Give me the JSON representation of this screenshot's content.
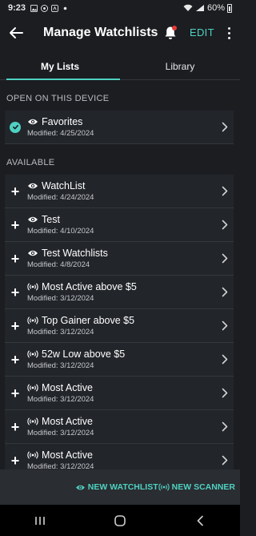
{
  "status": {
    "time": "9:23",
    "battery": "60%"
  },
  "header": {
    "title": "Manage Watchlists",
    "edit_label": "EDIT"
  },
  "tabs": [
    {
      "label": "My Lists",
      "active": true
    },
    {
      "label": "Library",
      "active": false
    }
  ],
  "sections": {
    "open_header": "OPEN ON THIS DEVICE",
    "available_header": "AVAILABLE"
  },
  "open_lists": [
    {
      "name": "Favorites",
      "modified": "Modified: 4/25/2024",
      "kind": "watchlist"
    }
  ],
  "available_lists": [
    {
      "name": "WatchList",
      "modified": "Modified: 4/24/2024",
      "kind": "watchlist"
    },
    {
      "name": "Test",
      "modified": "Modified: 4/10/2024",
      "kind": "watchlist"
    },
    {
      "name": "Test Watchlists",
      "modified": "Modified: 4/8/2024",
      "kind": "watchlist"
    },
    {
      "name": "Most Active above $5",
      "modified": "Modified: 3/12/2024",
      "kind": "scanner"
    },
    {
      "name": "Top Gainer above $5",
      "modified": "Modified: 3/12/2024",
      "kind": "scanner"
    },
    {
      "name": "52w Low above $5",
      "modified": "Modified: 3/12/2024",
      "kind": "scanner"
    },
    {
      "name": "Most Active",
      "modified": "Modified: 3/12/2024",
      "kind": "scanner"
    },
    {
      "name": "Most Active",
      "modified": "Modified: 3/12/2024",
      "kind": "scanner"
    },
    {
      "name": "Most Active",
      "modified": "Modified: 3/12/2024",
      "kind": "scanner"
    }
  ],
  "bottom_actions": {
    "new_watchlist": "NEW WATCHLIST",
    "new_scanner": "NEW SCANNER"
  },
  "colors": {
    "accent": "#4fd1c2",
    "background": "#1b1d21",
    "row_background": "#22252a",
    "notification_dot": "#e53935"
  }
}
